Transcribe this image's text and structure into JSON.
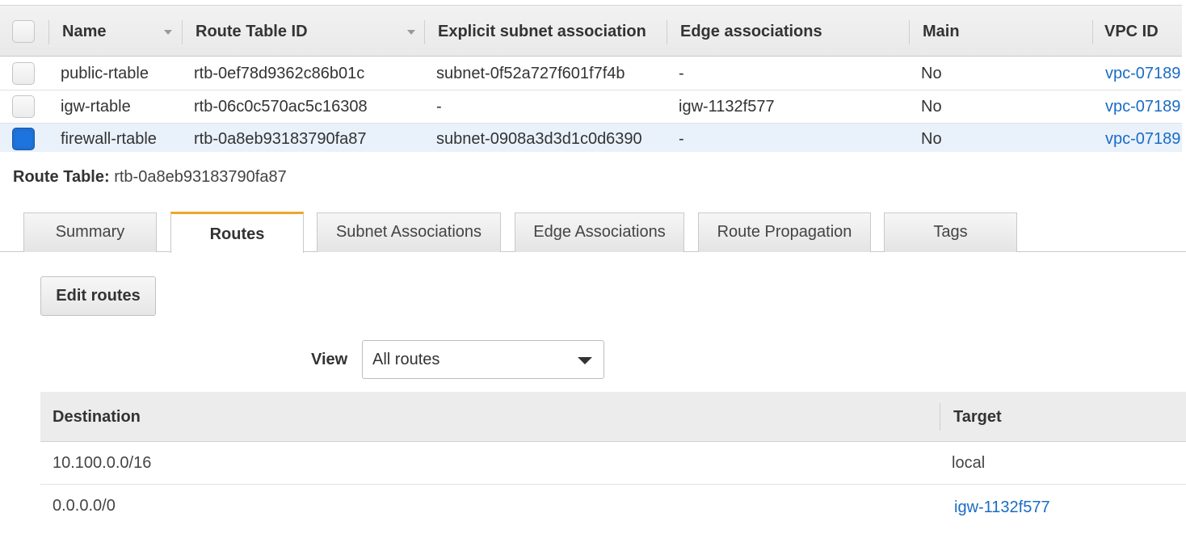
{
  "route_tables": {
    "columns": [
      "Name",
      "Route Table ID",
      "Explicit subnet association",
      "Edge associations",
      "Main",
      "VPC ID"
    ],
    "rows": [
      {
        "name": "public-rtable",
        "id": "rtb-0ef78d9362c86b01c",
        "subnet": "subnet-0f52a727f601f7f4b",
        "edge": "-",
        "main": "No",
        "vpc": "vpc-07189",
        "selected": false
      },
      {
        "name": "igw-rtable",
        "id": "rtb-06c0c570ac5c16308",
        "subnet": "-",
        "edge": "igw-1132f577",
        "main": "No",
        "vpc": "vpc-07189",
        "selected": false
      },
      {
        "name": "firewall-rtable",
        "id": "rtb-0a8eb93183790fa87",
        "subnet": "subnet-0908a3d3d1c0d6390",
        "edge": "-",
        "main": "No",
        "vpc": "vpc-07189",
        "selected": true
      }
    ]
  },
  "detail": {
    "label": "Route Table:",
    "value": "rtb-0a8eb93183790fa87"
  },
  "tabs": [
    {
      "label": "Summary",
      "active": false
    },
    {
      "label": "Routes",
      "active": true
    },
    {
      "label": "Subnet Associations",
      "active": false
    },
    {
      "label": "Edge Associations",
      "active": false
    },
    {
      "label": "Route Propagation",
      "active": false
    },
    {
      "label": "Tags",
      "active": false
    }
  ],
  "edit_routes_label": "Edit routes",
  "view": {
    "label": "View",
    "selected": "All routes"
  },
  "routes": {
    "columns": [
      "Destination",
      "Target"
    ],
    "rows": [
      {
        "destination": "10.100.0.0/16",
        "target": "local",
        "target_link": false
      },
      {
        "destination": "0.0.0.0/0",
        "target": "igw-1132f577",
        "target_link": true
      }
    ]
  },
  "colors": {
    "link": "#1a6cc4",
    "active_tab_accent": "#f0a52a",
    "selected_row": "#e9f1fb",
    "checkbox_checked": "#1e74de"
  }
}
